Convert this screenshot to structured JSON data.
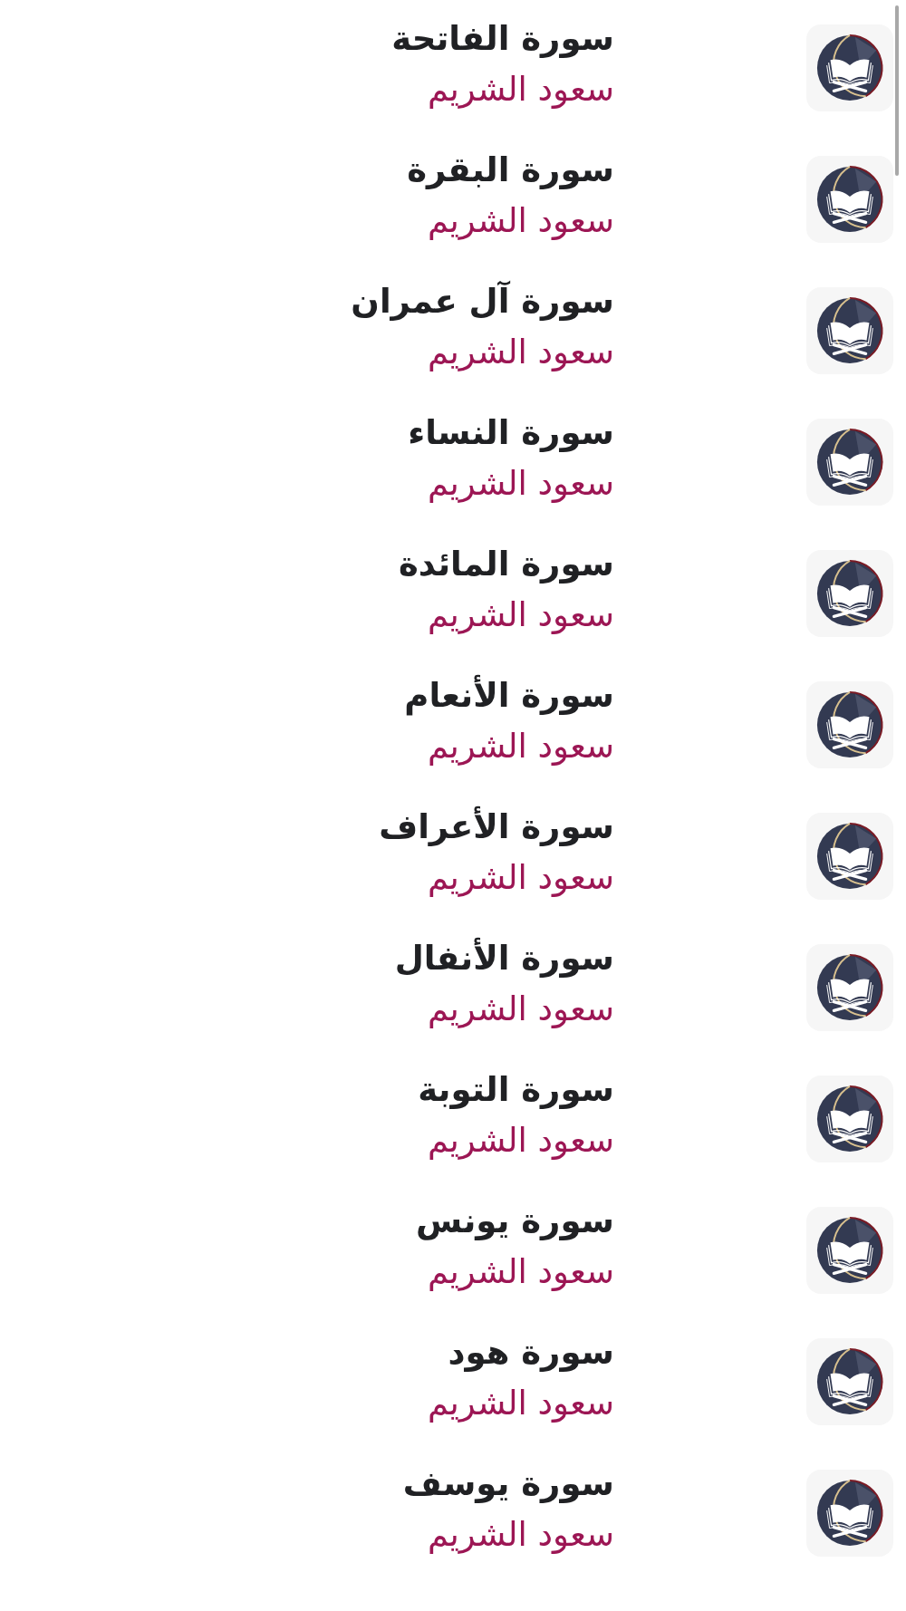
{
  "surahs": [
    {
      "title": "سورة الفاتحة",
      "reciter": "سعود الشريم"
    },
    {
      "title": "سورة البقرة",
      "reciter": "سعود الشريم"
    },
    {
      "title": "سورة آل عمران",
      "reciter": "سعود الشريم"
    },
    {
      "title": "سورة النساء",
      "reciter": "سعود الشريم"
    },
    {
      "title": "سورة المائدة",
      "reciter": "سعود الشريم"
    },
    {
      "title": "سورة الأنعام",
      "reciter": "سعود الشريم"
    },
    {
      "title": "سورة الأعراف",
      "reciter": "سعود الشريم"
    },
    {
      "title": "سورة الأنفال",
      "reciter": "سعود الشريم"
    },
    {
      "title": "سورة التوبة",
      "reciter": "سعود الشريم"
    },
    {
      "title": "سورة يونس",
      "reciter": "سعود الشريم"
    },
    {
      "title": "سورة هود",
      "reciter": "سعود الشريم"
    },
    {
      "title": "سورة يوسف",
      "reciter": "سعود الشريم"
    }
  ]
}
